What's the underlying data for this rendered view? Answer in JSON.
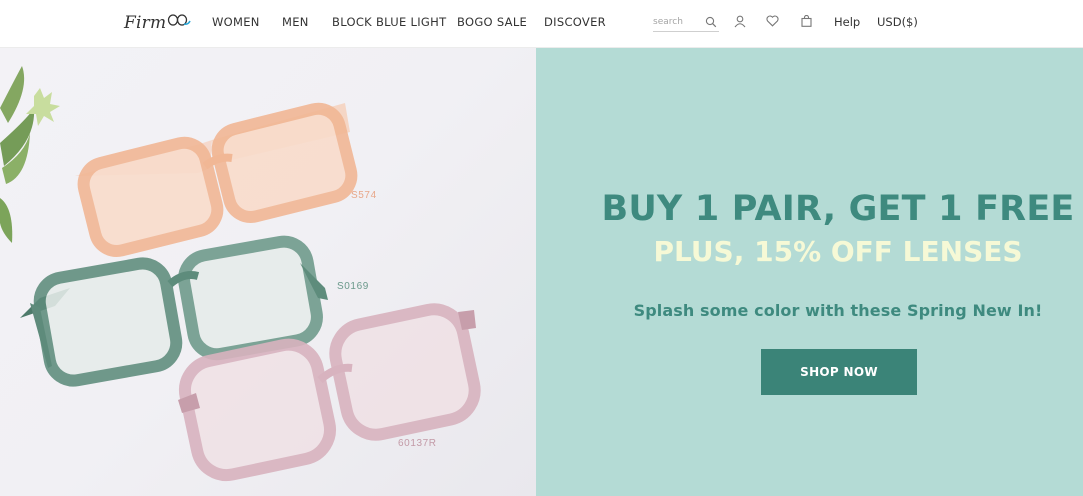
{
  "header": {
    "logo_text": "Firm",
    "nav": [
      "WOMEN",
      "MEN",
      "BLOCK BLUE LIGHT",
      "BOGO SALE",
      "DISCOVER"
    ],
    "search_placeholder": "search",
    "icons": [
      "search-icon",
      "user-icon",
      "heart-icon",
      "bag-icon"
    ],
    "help_label": "Help",
    "currency_label": "USD($)"
  },
  "hero": {
    "headline": "BUY 1 PAIR, GET 1 FREE",
    "subheadline": "PLUS, 15% OFF LENSES",
    "tagline": "Splash some color with these Spring New In!",
    "cta_label": "SHOP NOW",
    "product_labels": [
      "S574",
      "S0169",
      "60137R"
    ]
  },
  "colors": {
    "accent": "#3e8a7f",
    "panel_bg": "#b4dbd5",
    "button_bg": "#3b8478",
    "subheadline": "#f6f9d6"
  }
}
